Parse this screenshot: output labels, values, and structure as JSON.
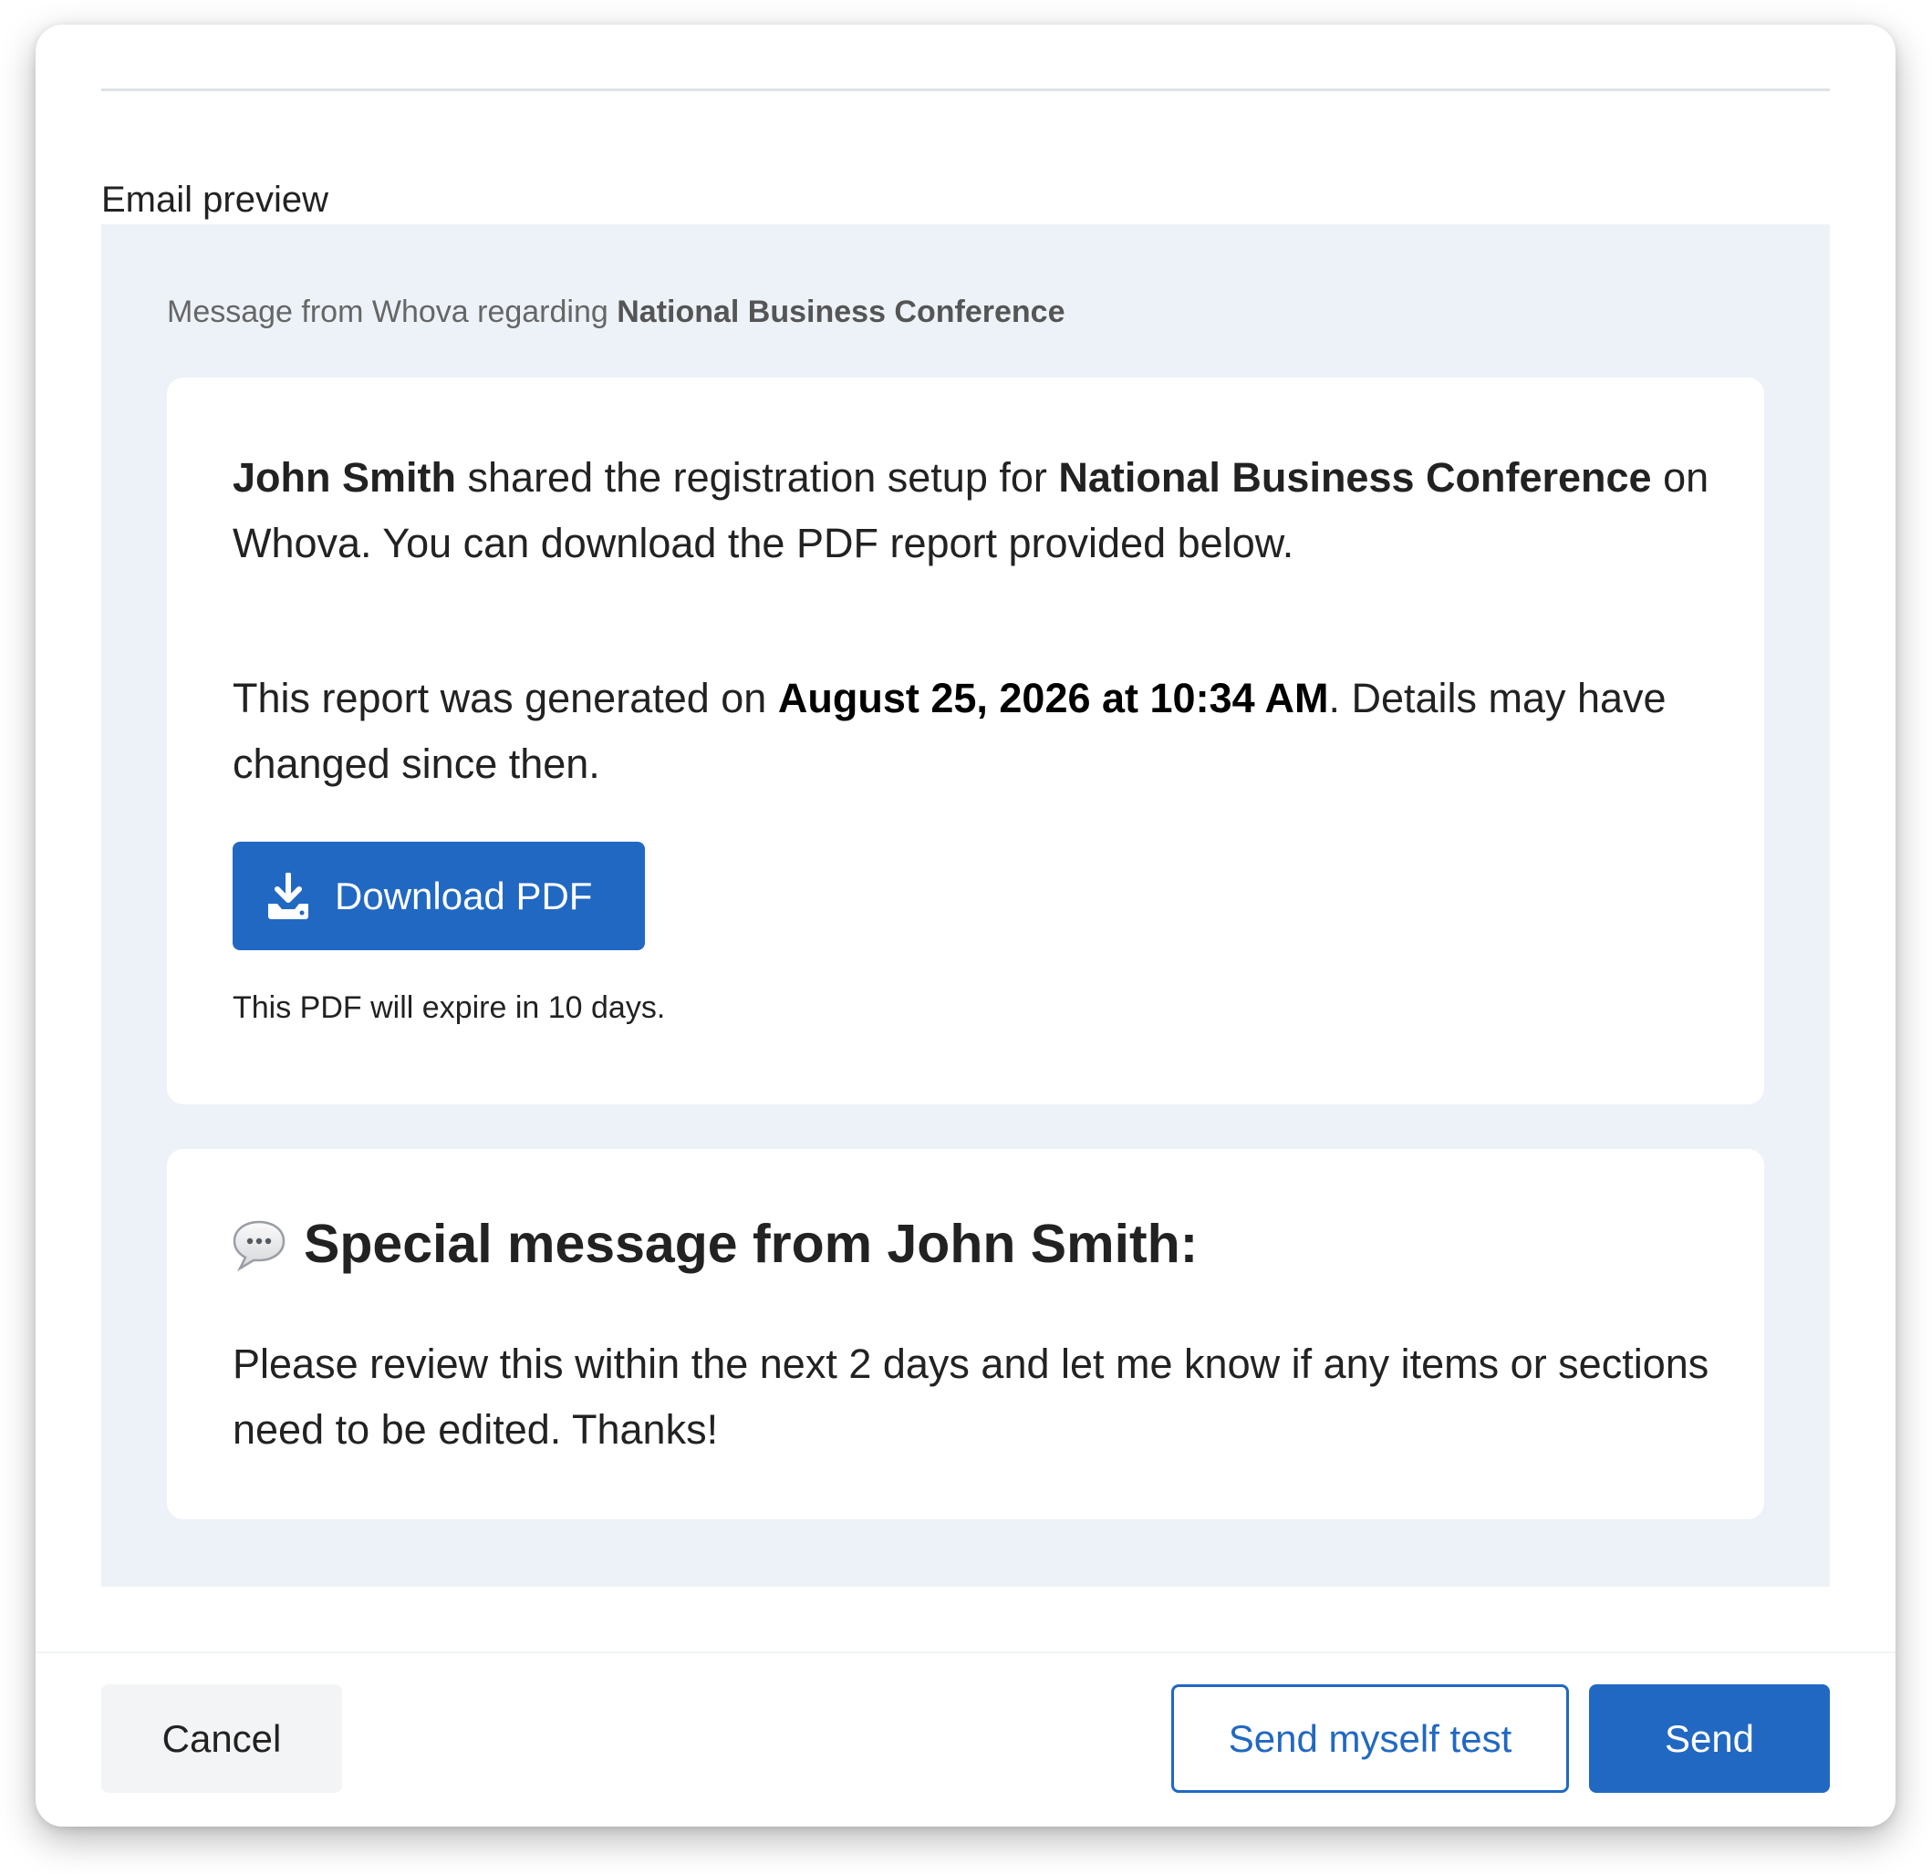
{
  "preview_section": {
    "label": "Email preview"
  },
  "email": {
    "from_prefix": "Message from Whova regarding",
    "event_name": "National Business Conference",
    "report_card": {
      "sender_name": "John Smith",
      "intro_middle": "shared the registration setup for",
      "event_name": "National Business Conference",
      "intro_end": "on Whova. You can download the PDF report provided below.",
      "generated_prefix": "This report was generated on",
      "generated_at": "August 25, 2026 at 10:34 AM",
      "generated_suffix": ". Details may have changed since then.",
      "download_label": "Download PDF",
      "download_icon": "download-icon",
      "expire_note": "This PDF will expire in 10 days."
    },
    "message_card": {
      "heading": "Special message from John Smith:",
      "heading_icon": "speech-bubble-icon",
      "body": "Please review this within the next 2 days and let me know if any items or sections need to be edited. Thanks!"
    }
  },
  "footer": {
    "cancel_label": "Cancel",
    "test_label": "Send myself test",
    "send_label": "Send"
  },
  "colors": {
    "accent": "#2168c2",
    "preview_background": "#edf2f8"
  }
}
